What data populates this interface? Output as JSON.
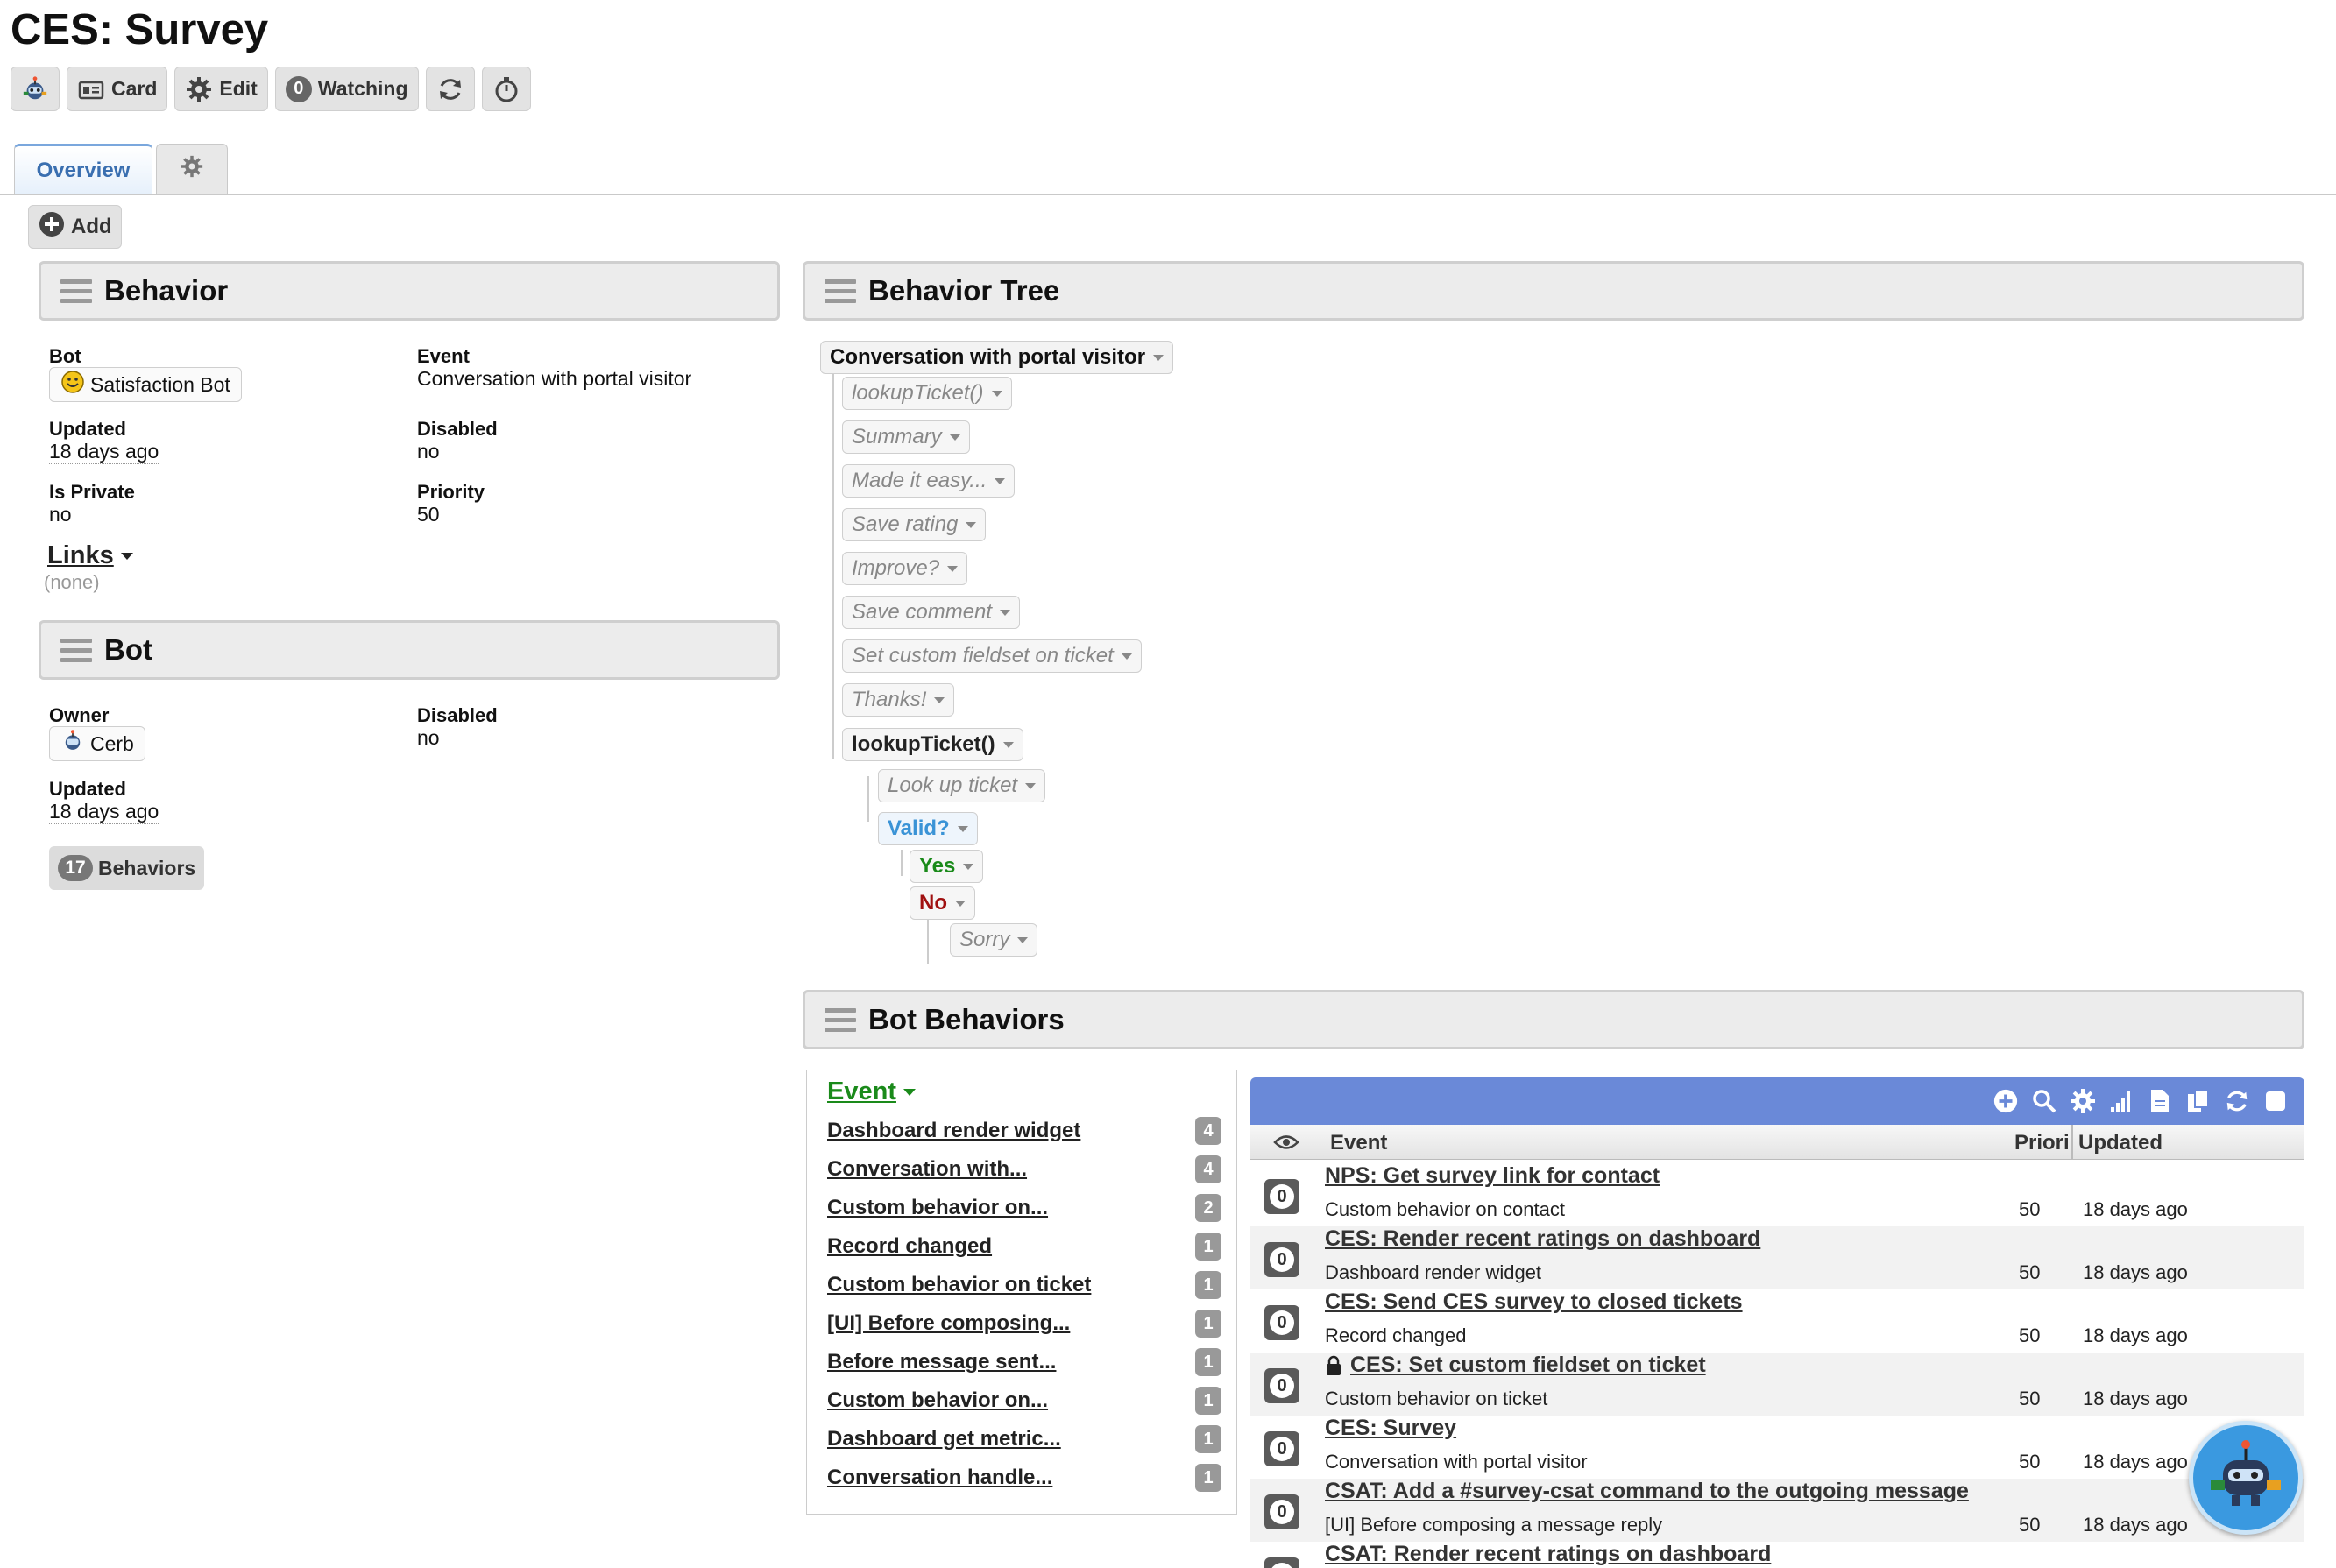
{
  "page": {
    "title": "CES: Survey"
  },
  "toolbar": {
    "card_label": "Card",
    "edit_label": "Edit",
    "watching_count": "0",
    "watching_label": "Watching"
  },
  "tabs": {
    "overview": "Overview"
  },
  "add_label": "Add",
  "behavior_widget": {
    "title": "Behavior",
    "bot_label": "Bot",
    "bot_value": "Satisfaction Bot",
    "event_label": "Event",
    "event_value": "Conversation with portal visitor",
    "updated_label": "Updated",
    "updated_value": "18 days ago",
    "disabled_label": "Disabled",
    "disabled_value": "no",
    "private_label": "Is Private",
    "private_value": "no",
    "priority_label": "Priority",
    "priority_value": "50",
    "links_label": "Links",
    "links_value": "(none)"
  },
  "bot_widget": {
    "title": "Bot",
    "owner_label": "Owner",
    "owner_value": "Cerb",
    "disabled_label": "Disabled",
    "disabled_value": "no",
    "updated_label": "Updated",
    "updated_value": "18 days ago",
    "behaviors_count": "17",
    "behaviors_label": "Behaviors"
  },
  "tree_widget": {
    "title": "Behavior Tree",
    "root": "Conversation with portal visitor",
    "nodes": [
      "lookupTicket()",
      "Summary",
      "Made it easy...",
      "Save rating",
      "Improve?",
      "Save comment",
      "Set custom fieldset on ticket",
      "Thanks!"
    ],
    "subroutine": "lookupTicket()",
    "sub_action": "Look up ticket",
    "decision": "Valid?",
    "yes": "Yes",
    "no": "No",
    "sorry": "Sorry"
  },
  "bot_behaviors": {
    "title": "Bot Behaviors",
    "facet_title": "Event",
    "facets": [
      {
        "label": "Dashboard render widget",
        "count": "4"
      },
      {
        "label": "Conversation with...",
        "count": "4"
      },
      {
        "label": "Custom behavior on...",
        "count": "2"
      },
      {
        "label": "Record changed",
        "count": "1"
      },
      {
        "label": "Custom behavior on ticket",
        "count": "1"
      },
      {
        "label": "[UI] Before composing...",
        "count": "1"
      },
      {
        "label": "Before message sent...",
        "count": "1"
      },
      {
        "label": "Custom behavior on...",
        "count": "1"
      },
      {
        "label": "Dashboard get metric...",
        "count": "1"
      },
      {
        "label": "Conversation handle...",
        "count": "1"
      }
    ],
    "columns": {
      "event": "Event",
      "priority": "Priori",
      "updated": "Updated"
    },
    "rows": [
      {
        "name": "NPS: Get survey link for contact",
        "event": "Custom behavior on contact",
        "priority": "50",
        "updated": "18 days ago",
        "locked": false,
        "count": "0"
      },
      {
        "name": "CES: Render recent ratings on dashboard",
        "event": "Dashboard render widget",
        "priority": "50",
        "updated": "18 days ago",
        "locked": false,
        "count": "0"
      },
      {
        "name": "CES: Send CES survey to closed tickets",
        "event": "Record changed",
        "priority": "50",
        "updated": "18 days ago",
        "locked": false,
        "count": "0"
      },
      {
        "name": "CES: Set custom fieldset on ticket",
        "event": "Custom behavior on ticket",
        "priority": "50",
        "updated": "18 days ago",
        "locked": true,
        "count": "0"
      },
      {
        "name": "CES: Survey",
        "event": "Conversation with portal visitor",
        "priority": "50",
        "updated": "18 days ago",
        "locked": false,
        "count": "0"
      },
      {
        "name": "CSAT: Add a #survey-csat command to the outgoing message",
        "event": "[UI] Before composing a message reply",
        "priority": "50",
        "updated": "18 days ago",
        "locked": false,
        "count": "0"
      },
      {
        "name": "CSAT: Render recent ratings on dashboard",
        "event": "",
        "priority": "",
        "updated": "",
        "locked": false,
        "count": "0"
      }
    ]
  },
  "colors": {
    "accent": "#6a89d8",
    "yes": "#1a8a1a",
    "no": "#a01010",
    "decision": "#3a93d6"
  },
  "icons": [
    "bot-avatar-icon",
    "card-icon",
    "gear-icon",
    "refresh-icon",
    "stopwatch-icon",
    "plus-circle-icon",
    "search-icon",
    "chart-icon",
    "export-icon",
    "copy-icon",
    "checkbox-icon",
    "eye-icon",
    "lock-icon",
    "helper-bot-icon"
  ]
}
